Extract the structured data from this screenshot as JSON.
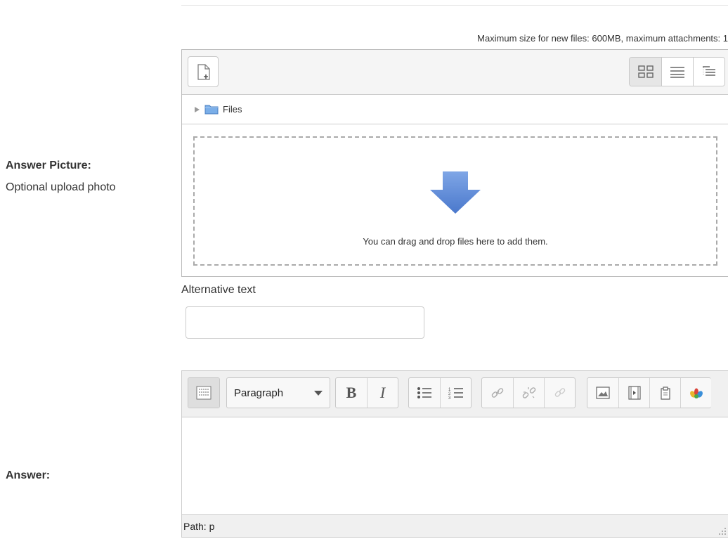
{
  "filepicker": {
    "max_size_text": "Maximum size for new files: 600MB, maximum attachments: 1",
    "folder_label": "Files",
    "drop_message": "You can drag and drop files here to add them.",
    "view_modes": [
      "icons-view",
      "details-view",
      "tree-view"
    ]
  },
  "answer_picture": {
    "label": "Answer Picture:",
    "hint": "Optional upload photo"
  },
  "alt_text": {
    "label": "Alternative text",
    "value": ""
  },
  "answer": {
    "label": "Answer:",
    "format_select": "Paragraph",
    "path_text": "Path: p"
  },
  "colors": {
    "accent_arrow": "#5b8bd6",
    "folder": "#7aaee8"
  }
}
